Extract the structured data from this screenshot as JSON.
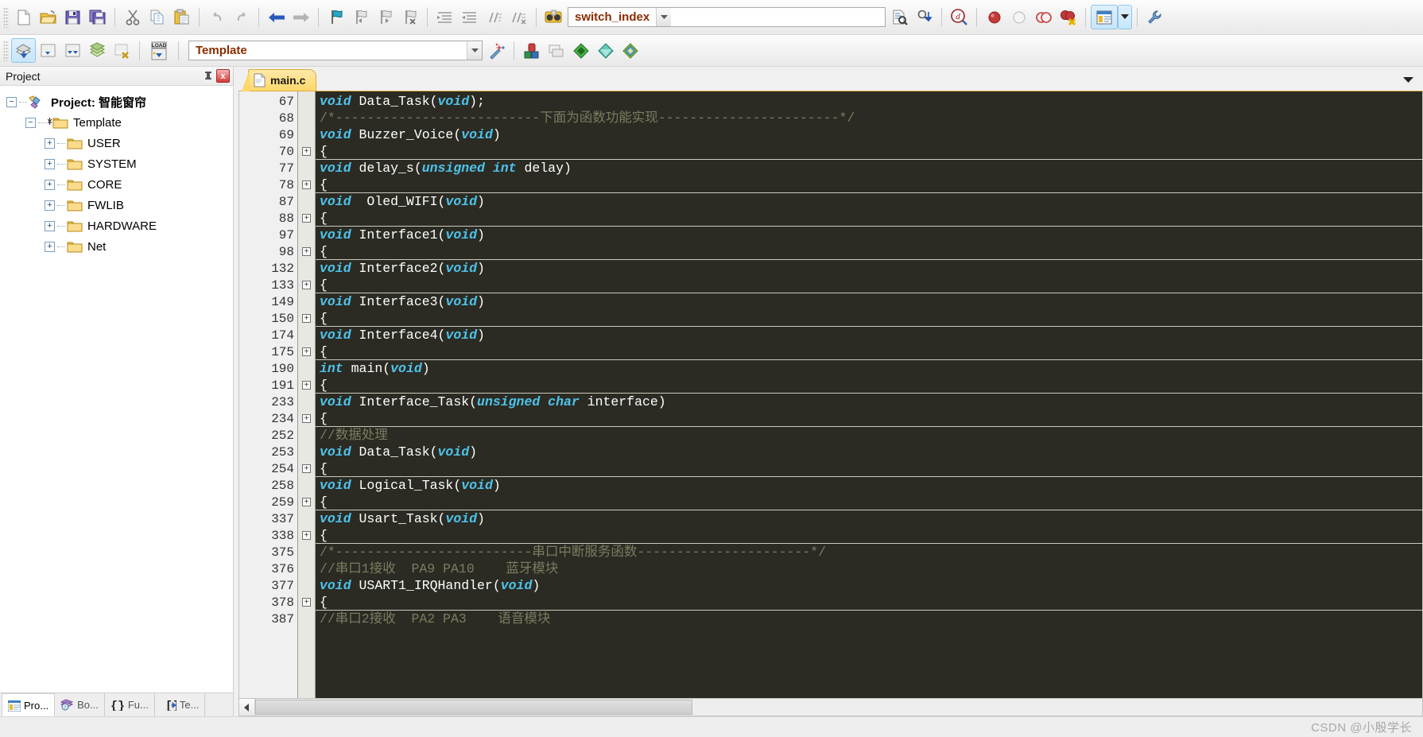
{
  "toolbar1": {
    "buttons": [
      {
        "name": "new-file-button",
        "icon": "new-file-icon",
        "title": "New"
      },
      {
        "name": "open-file-button",
        "icon": "open-folder-icon",
        "title": "Open"
      },
      {
        "name": "save-button",
        "icon": "save-icon",
        "title": "Save"
      },
      {
        "name": "save-all-button",
        "icon": "save-all-icon",
        "title": "Save All"
      },
      {
        "name": "cut-button",
        "icon": "scissors-icon",
        "title": "Cut"
      },
      {
        "name": "copy-button",
        "icon": "copy-icon",
        "title": "Copy"
      },
      {
        "name": "paste-button",
        "icon": "paste-icon",
        "title": "Paste"
      },
      {
        "name": "undo-button",
        "icon": "undo-arrow-icon",
        "title": "Undo"
      },
      {
        "name": "redo-button",
        "icon": "redo-arrow-icon",
        "title": "Redo"
      },
      {
        "name": "navigate-back-button",
        "icon": "arrow-left-icon",
        "title": "Back"
      },
      {
        "name": "navigate-forward-button",
        "icon": "arrow-right-icon",
        "title": "Forward"
      },
      {
        "name": "bookmark-toggle-button",
        "icon": "bookmark-flag-icon",
        "title": "Insert/Remove Bookmark"
      },
      {
        "name": "bookmark-prev-button",
        "icon": "bookmark-prev-icon",
        "title": "Previous Bookmark"
      },
      {
        "name": "bookmark-next-button",
        "icon": "bookmark-next-icon",
        "title": "Next Bookmark"
      },
      {
        "name": "bookmark-clear-button",
        "icon": "bookmark-clear-icon",
        "title": "Clear All Bookmarks"
      },
      {
        "name": "indent-right-button",
        "icon": "indent-right-icon",
        "title": "Indent"
      },
      {
        "name": "indent-left-button",
        "icon": "indent-left-icon",
        "title": "Outdent"
      },
      {
        "name": "comment-button",
        "icon": "comment-lines-icon",
        "title": "Comment"
      },
      {
        "name": "uncomment-button",
        "icon": "uncomment-lines-icon",
        "title": "Uncomment"
      }
    ],
    "search_icon": "binoculars-icon",
    "search_value": "switch_index",
    "find_in_files_button": "find-in-files-icon",
    "find_next_button": "find-next-icon",
    "browse_symbol_button": "browse-symbol-icon",
    "breakpoint_buttons": [
      {
        "name": "insert-breakpoint-button",
        "icon": "breakpoint-red-icon"
      },
      {
        "name": "kill-breakpoint-button",
        "icon": "breakpoint-grey-icon"
      },
      {
        "name": "disable-breakpoint-button",
        "icon": "breakpoint-outline-icon"
      },
      {
        "name": "kill-all-breakpoints-button",
        "icon": "breakpoint-delete-icon"
      }
    ],
    "window_manager_button": "manage-windows-icon",
    "window_manager_dropdown": "chevron-down-icon",
    "configure_button": "wrench-icon"
  },
  "toolbar2": {
    "buttons": [
      {
        "name": "translate-button",
        "icon": "translate-icon",
        "active": true
      },
      {
        "name": "build-button",
        "icon": "build-icon"
      },
      {
        "name": "rebuild-button",
        "icon": "rebuild-all-icon"
      },
      {
        "name": "batch-build-button",
        "icon": "batch-build-icon"
      },
      {
        "name": "stop-build-button",
        "icon": "stop-build-icon"
      },
      {
        "name": "download-button",
        "icon": "load-download-icon"
      }
    ],
    "target_value": "Template",
    "target_dropdown": "chevron-down-icon",
    "manage-project-items-button": "magic-wand-icon",
    "right_buttons": [
      {
        "name": "options-for-target-button",
        "icon": "target-options-icon"
      },
      {
        "name": "multi-project-button",
        "icon": "multi-project-icon"
      },
      {
        "name": "pack-installer-button",
        "icon": "green-diamond-icon"
      },
      {
        "name": "manage-runtime-button",
        "icon": "cyan-diamond-icon"
      },
      {
        "name": "select-software-packs-button",
        "icon": "packs-diamond-icon"
      }
    ]
  },
  "project_pane": {
    "title": "Project",
    "pin_icon": "pin-icon",
    "close_icon": "close-icon",
    "tree": [
      {
        "label": "Project: 智能窗帘",
        "icon": "project-icon",
        "depth": 0,
        "expander": "minus",
        "root": true
      },
      {
        "label": "Template",
        "icon": "target-folder-icon",
        "depth": 1,
        "expander": "minus",
        "root": false
      },
      {
        "label": "USER",
        "icon": "folder-icon",
        "depth": 2,
        "expander": "plus",
        "root": false
      },
      {
        "label": "SYSTEM",
        "icon": "folder-icon",
        "depth": 2,
        "expander": "plus",
        "root": false
      },
      {
        "label": "CORE",
        "icon": "folder-icon",
        "depth": 2,
        "expander": "plus",
        "root": false
      },
      {
        "label": "FWLIB",
        "icon": "folder-icon",
        "depth": 2,
        "expander": "plus",
        "root": false
      },
      {
        "label": "HARDWARE",
        "icon": "folder-icon",
        "depth": 2,
        "expander": "plus",
        "root": false
      },
      {
        "label": "Net",
        "icon": "folder-icon",
        "depth": 2,
        "expander": "plus",
        "root": false
      }
    ],
    "tabs": [
      {
        "label": "Pro...",
        "icon": "project-window-icon",
        "selected": true,
        "name": "tab-project"
      },
      {
        "label": "Bo...",
        "icon": "books-icon",
        "selected": false,
        "name": "tab-books"
      },
      {
        "label": "Fu...",
        "icon": "braces-icon",
        "selected": false,
        "name": "tab-functions"
      },
      {
        "label": "Te...",
        "icon": "templates-icon",
        "selected": false,
        "name": "tab-templates"
      }
    ]
  },
  "editor": {
    "tab_label": "main.c",
    "tab_icon": "c-file-icon",
    "dropdown_icon": "chevron-down-icon",
    "scroll_left_icon": "chevron-left-icon",
    "lines": [
      {
        "num": "67",
        "fold": false,
        "fold_sep": false,
        "tokens": [
          {
            "t": "void",
            "c": "kw"
          },
          {
            "t": " Data_Task(",
            "c": "id"
          },
          {
            "t": "void",
            "c": "kw"
          },
          {
            "t": ");",
            "c": "id"
          }
        ]
      },
      {
        "num": "68",
        "fold": false,
        "fold_sep": false,
        "tokens": [
          {
            "t": "/*--------------------------下面为函数功能实现-----------------------*/",
            "c": "cm"
          }
        ]
      },
      {
        "num": "69",
        "fold": false,
        "fold_sep": false,
        "tokens": [
          {
            "t": "void",
            "c": "kw"
          },
          {
            "t": " Buzzer_Voice(",
            "c": "id"
          },
          {
            "t": "void",
            "c": "kw"
          },
          {
            "t": ")",
            "c": "id"
          }
        ]
      },
      {
        "num": "70",
        "fold": true,
        "fold_sep": true,
        "tokens": [
          {
            "t": "{",
            "c": "id"
          }
        ]
      },
      {
        "num": "77",
        "fold": false,
        "fold_sep": false,
        "tokens": [
          {
            "t": "void",
            "c": "kw"
          },
          {
            "t": " delay_s(",
            "c": "id"
          },
          {
            "t": "unsigned int",
            "c": "kw"
          },
          {
            "t": " delay)",
            "c": "id"
          }
        ]
      },
      {
        "num": "78",
        "fold": true,
        "fold_sep": true,
        "tokens": [
          {
            "t": "{",
            "c": "id"
          }
        ]
      },
      {
        "num": "87",
        "fold": false,
        "fold_sep": false,
        "tokens": [
          {
            "t": "void",
            "c": "kw"
          },
          {
            "t": "  Oled_WIFI(",
            "c": "id"
          },
          {
            "t": "void",
            "c": "kw"
          },
          {
            "t": ")",
            "c": "id"
          }
        ]
      },
      {
        "num": "88",
        "fold": true,
        "fold_sep": true,
        "tokens": [
          {
            "t": "{",
            "c": "id"
          }
        ]
      },
      {
        "num": "97",
        "fold": false,
        "fold_sep": false,
        "tokens": [
          {
            "t": "void",
            "c": "kw"
          },
          {
            "t": " Interface1(",
            "c": "id"
          },
          {
            "t": "void",
            "c": "kw"
          },
          {
            "t": ")",
            "c": "id"
          }
        ]
      },
      {
        "num": "98",
        "fold": true,
        "fold_sep": true,
        "tokens": [
          {
            "t": "{",
            "c": "id"
          }
        ]
      },
      {
        "num": "132",
        "fold": false,
        "fold_sep": false,
        "tokens": [
          {
            "t": "void",
            "c": "kw"
          },
          {
            "t": " Interface2(",
            "c": "id"
          },
          {
            "t": "void",
            "c": "kw"
          },
          {
            "t": ")",
            "c": "id"
          }
        ]
      },
      {
        "num": "133",
        "fold": true,
        "fold_sep": true,
        "tokens": [
          {
            "t": "{",
            "c": "id"
          }
        ]
      },
      {
        "num": "149",
        "fold": false,
        "fold_sep": false,
        "tokens": [
          {
            "t": "void",
            "c": "kw"
          },
          {
            "t": " Interface3(",
            "c": "id"
          },
          {
            "t": "void",
            "c": "kw"
          },
          {
            "t": ")",
            "c": "id"
          }
        ]
      },
      {
        "num": "150",
        "fold": true,
        "fold_sep": true,
        "tokens": [
          {
            "t": "{",
            "c": "id"
          }
        ]
      },
      {
        "num": "174",
        "fold": false,
        "fold_sep": false,
        "tokens": [
          {
            "t": "void",
            "c": "kw"
          },
          {
            "t": " Interface4(",
            "c": "id"
          },
          {
            "t": "void",
            "c": "kw"
          },
          {
            "t": ")",
            "c": "id"
          }
        ]
      },
      {
        "num": "175",
        "fold": true,
        "fold_sep": true,
        "tokens": [
          {
            "t": "{",
            "c": "id"
          }
        ]
      },
      {
        "num": "190",
        "fold": false,
        "fold_sep": false,
        "tokens": [
          {
            "t": "int",
            "c": "kw"
          },
          {
            "t": " main(",
            "c": "id"
          },
          {
            "t": "void",
            "c": "kw"
          },
          {
            "t": ")",
            "c": "id"
          }
        ]
      },
      {
        "num": "191",
        "fold": true,
        "fold_sep": true,
        "tokens": [
          {
            "t": "{",
            "c": "id"
          }
        ]
      },
      {
        "num": "233",
        "fold": false,
        "fold_sep": false,
        "tokens": [
          {
            "t": "void",
            "c": "kw"
          },
          {
            "t": " Interface_Task(",
            "c": "id"
          },
          {
            "t": "unsigned char",
            "c": "kw"
          },
          {
            "t": " interface)",
            "c": "id"
          }
        ]
      },
      {
        "num": "234",
        "fold": true,
        "fold_sep": true,
        "tokens": [
          {
            "t": "{",
            "c": "id"
          }
        ]
      },
      {
        "num": "252",
        "fold": false,
        "fold_sep": false,
        "tokens": [
          {
            "t": "//数据处理",
            "c": "cm"
          }
        ]
      },
      {
        "num": "253",
        "fold": false,
        "fold_sep": false,
        "tokens": [
          {
            "t": "void",
            "c": "kw"
          },
          {
            "t": " Data_Task(",
            "c": "id"
          },
          {
            "t": "void",
            "c": "kw"
          },
          {
            "t": ")",
            "c": "id"
          }
        ]
      },
      {
        "num": "254",
        "fold": true,
        "fold_sep": true,
        "tokens": [
          {
            "t": "{",
            "c": "id"
          }
        ]
      },
      {
        "num": "258",
        "fold": false,
        "fold_sep": false,
        "tokens": [
          {
            "t": "void",
            "c": "kw"
          },
          {
            "t": " Logical_Task(",
            "c": "id"
          },
          {
            "t": "void",
            "c": "kw"
          },
          {
            "t": ")",
            "c": "id"
          }
        ]
      },
      {
        "num": "259",
        "fold": true,
        "fold_sep": true,
        "tokens": [
          {
            "t": "{",
            "c": "id"
          }
        ]
      },
      {
        "num": "337",
        "fold": false,
        "fold_sep": false,
        "tokens": [
          {
            "t": "void",
            "c": "kw"
          },
          {
            "t": " Usart_Task(",
            "c": "id"
          },
          {
            "t": "void",
            "c": "kw"
          },
          {
            "t": ")",
            "c": "id"
          }
        ]
      },
      {
        "num": "338",
        "fold": true,
        "fold_sep": true,
        "tokens": [
          {
            "t": "{",
            "c": "id"
          }
        ]
      },
      {
        "num": "375",
        "fold": false,
        "fold_sep": false,
        "tokens": [
          {
            "t": "/*-------------------------串口中断服务函数----------------------*/",
            "c": "cm"
          }
        ]
      },
      {
        "num": "376",
        "fold": false,
        "fold_sep": false,
        "tokens": [
          {
            "t": "//串口1接收  PA9 PA10    蓝牙模块",
            "c": "cm"
          }
        ]
      },
      {
        "num": "377",
        "fold": false,
        "fold_sep": false,
        "tokens": [
          {
            "t": "void",
            "c": "kw"
          },
          {
            "t": " USART1_IRQHandler(",
            "c": "id"
          },
          {
            "t": "void",
            "c": "kw"
          },
          {
            "t": ")",
            "c": "id"
          }
        ]
      },
      {
        "num": "378",
        "fold": true,
        "fold_sep": true,
        "tokens": [
          {
            "t": "{",
            "c": "id"
          }
        ]
      },
      {
        "num": "387",
        "fold": false,
        "fold_sep": false,
        "tokens": [
          {
            "t": "//串口2接收  PA2 PA3    语音模块",
            "c": "cm"
          }
        ]
      }
    ]
  },
  "statusbar": {
    "watermark": "CSDN @小殷学长"
  },
  "colors": {
    "editor_bg": "#2b2b24",
    "keyword": "#4ec3ea",
    "comment": "#7d7a5e",
    "text": "#e6e6e6",
    "tab_active": "#ffd86b",
    "accent_orange": "#8b2b00"
  }
}
